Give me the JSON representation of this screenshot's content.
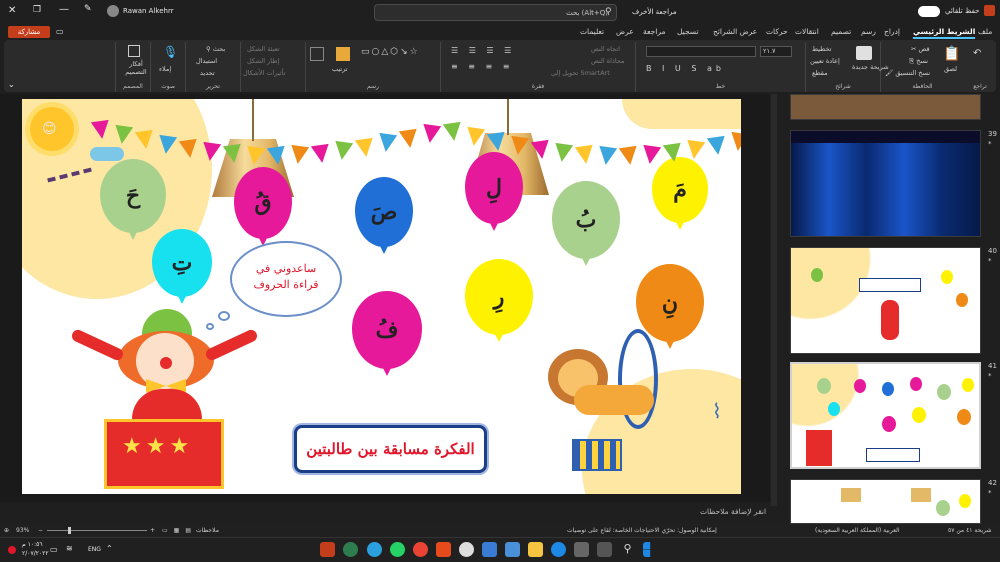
{
  "window": {
    "user": "Rawan Alkehrr",
    "autosave_label": "حفظ تلقائي",
    "search_placeholder": "بحث (Alt+Q)",
    "review_label": "مراجعة الأخرف",
    "share_label": "مشاركة"
  },
  "tabs": [
    "ملف",
    "الشريط الرئيسي",
    "إدراج",
    "رسم",
    "تصميم",
    "انتقالات",
    "حركات",
    "عرض الشرائح",
    "تسجيل",
    "مراجعة",
    "عرض",
    "تعليمات"
  ],
  "ribbon": {
    "groups": [
      "تراجع",
      "الحافظة",
      "شرائح",
      "خط",
      "فقرة",
      "رسم",
      "تحرير",
      "صوت",
      "المصمم"
    ],
    "paste": "لصق",
    "cut": "قص",
    "copy": "نسخ",
    "format_painter": "نسخ التنسيق",
    "new_slide": "شريحة جديدة",
    "layout": "تخطيط",
    "reset": "إعادة تعيين",
    "section": "مقطع",
    "font_size": "٢١.٧",
    "text_direction": "اتجاه النص",
    "align_text": "محاذاة النص",
    "smartart": "تحويل إلى SmartArt",
    "arrange": "ترتيب",
    "quick_styles": "أنماط سريعة",
    "shape_fill": "تعبئة الشكل",
    "shape_outline": "إطار الشكل",
    "shape_effects": "تأثيرات الأشكال",
    "find": "بحث",
    "replace": "استبدال",
    "select": "تحديد",
    "dictate": "إملاء",
    "designer": "أفكار التصميم"
  },
  "slide": {
    "letters": [
      "مَ",
      "بُ",
      "لِ",
      "صَ",
      "قُ",
      "حَ",
      "تِ",
      "نِ",
      "رِ",
      "فُ"
    ],
    "bubble_text": [
      "ساعدوني في",
      "قراءة الحروف"
    ],
    "title": "الفكرة مسابقة بين طالبتين"
  },
  "notes_placeholder": "انقر لإضافة ملاحظات",
  "thumbnails": [
    {
      "num": "39"
    },
    {
      "num": "40"
    },
    {
      "num": "41"
    },
    {
      "num": "42"
    }
  ],
  "status": {
    "slide_info": "شريحة ٤١ من ٥٧",
    "language": "العربية (المملكة العربية السعودية)",
    "accessibility": "إمكانية الوصول: تحرّي الاحتياجات الخاصة: لقاع على توصيات",
    "notes": "ملاحظات",
    "zoom": "93%"
  },
  "taskbar": {
    "lang": "ENG",
    "time": "١٠:٥٦ م",
    "date": "٢/٠٧/٢٠٢٢"
  },
  "colors": {
    "accent": "#4cc2ff",
    "share": "#c43e1c",
    "balloon_green": "#a9d18e",
    "balloon_magenta": "#e6199b",
    "balloon_blue": "#1f6fd6",
    "balloon_yellow": "#fff200",
    "balloon_orange": "#ef8a17",
    "balloon_cyan": "#17e0ef"
  }
}
